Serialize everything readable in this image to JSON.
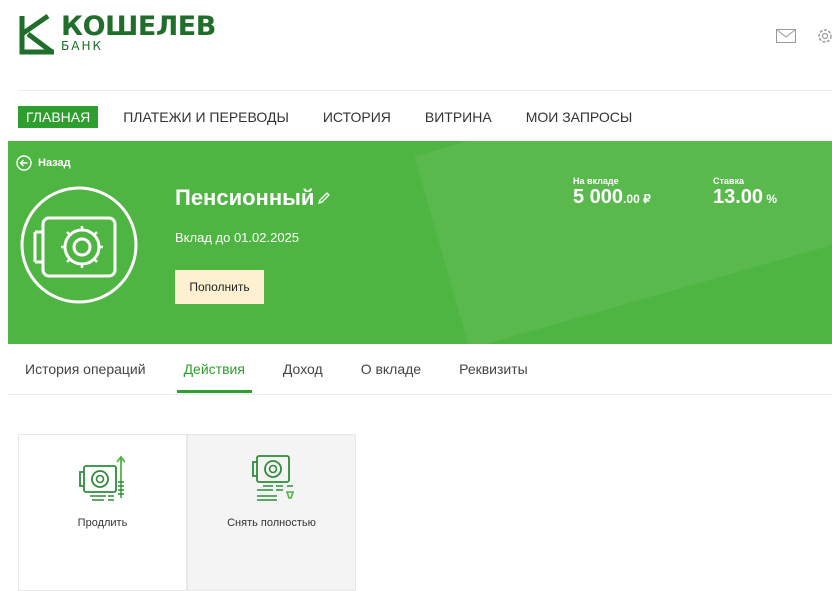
{
  "brand": {
    "name": "КОШЕЛЕВ",
    "sub": "БАНК",
    "color": "#1f6e2a"
  },
  "header": {
    "icons": [
      "mail-icon",
      "settings-icon"
    ]
  },
  "nav": {
    "items": [
      {
        "label": "ГЛАВНАЯ",
        "active": true
      },
      {
        "label": "ПЛАТЕЖИ И ПЕРЕВОДЫ"
      },
      {
        "label": "ИСТОРИЯ"
      },
      {
        "label": "ВИТРИНА"
      },
      {
        "label": "МОИ ЗАПРОСЫ"
      }
    ]
  },
  "deposit": {
    "back_label": "Назад",
    "title": "Пенсионный",
    "until": "Вклад до 01.02.2025",
    "topup_label": "Пополнить",
    "balance_label": "На вкладе",
    "balance_int": "5 000",
    "balance_frac": ".00 ₽",
    "rate_label": "Ставка",
    "rate_int": "13.00",
    "rate_unit": " %",
    "banner_color": "#4fb542"
  },
  "tabs": [
    {
      "label": "История операций"
    },
    {
      "label": "Действия",
      "active": true
    },
    {
      "label": "Доход"
    },
    {
      "label": "О вкладе"
    },
    {
      "label": "Реквизиты"
    }
  ],
  "actions": [
    {
      "label": "Продлить",
      "icon": "extend-deposit-icon"
    },
    {
      "label": "Снять полностью",
      "icon": "withdraw-all-icon"
    }
  ],
  "accent_color": "#2e9e2e"
}
